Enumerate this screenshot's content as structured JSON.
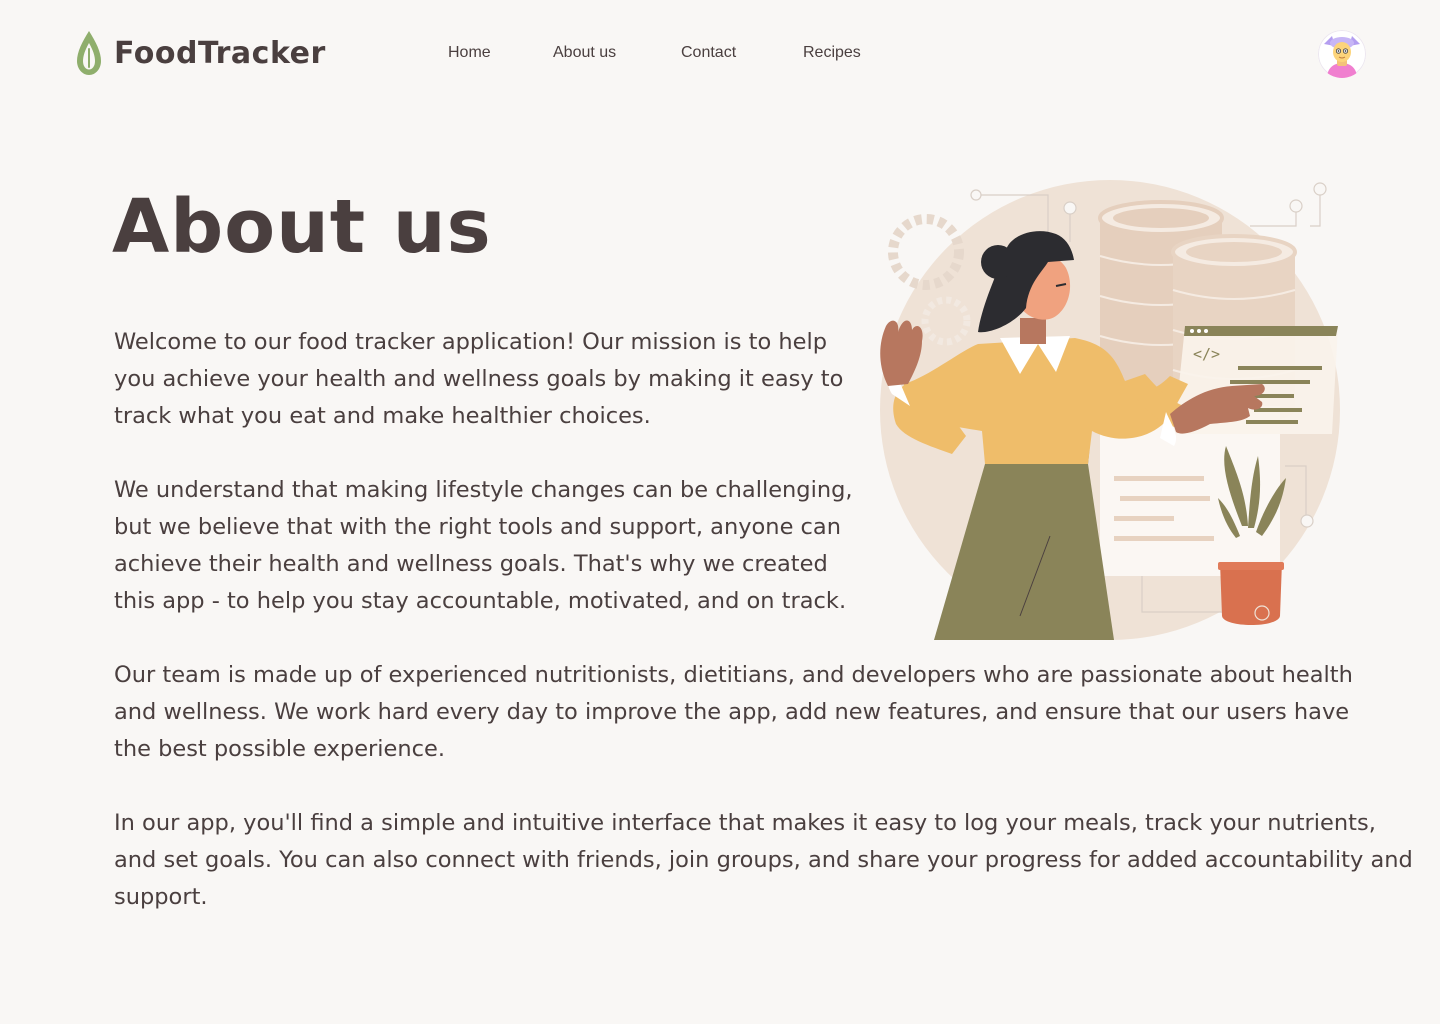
{
  "app": {
    "name": "FoodTracker"
  },
  "nav": {
    "items": [
      {
        "label": "Home"
      },
      {
        "label": "About us"
      },
      {
        "label": "Contact"
      },
      {
        "label": "Recipes"
      }
    ]
  },
  "page": {
    "title": "About us",
    "paragraphs": [
      "Welcome to our food tracker application! Our mission is to help you achieve your health and wellness goals by making it easy to track what you eat and make healthier choices.",
      "We understand that making lifestyle changes can be challenging, but we believe that with the right tools and support, anyone can achieve their health and wellness goals. That's why we created this app - to help you stay accountable, motivated, and on track.",
      "Our team is made up of experienced nutritionists, dietitians, and developers who are passionate about health and wellness. We work hard every day to improve the app, add new features, and ensure that our users have the best possible experience.",
      "In our app, you'll find a simple and intuitive interface that makes it easy to log your meals, track your nutrients, and set goals. You can also connect with friends, join groups, and share your progress for added accountability and support."
    ],
    "illustration_code_glyph": "</>"
  },
  "icons": {
    "logo": "leaf-drop-icon",
    "avatar": "user-avatar"
  },
  "colors": {
    "background": "#f9f7f5",
    "text": "#4a3f3f",
    "brand_green": "#8fae6c",
    "olive": "#8a8459",
    "mustard": "#efbd6a",
    "terracotta": "#d9714f",
    "beige": "#efe2d6"
  }
}
